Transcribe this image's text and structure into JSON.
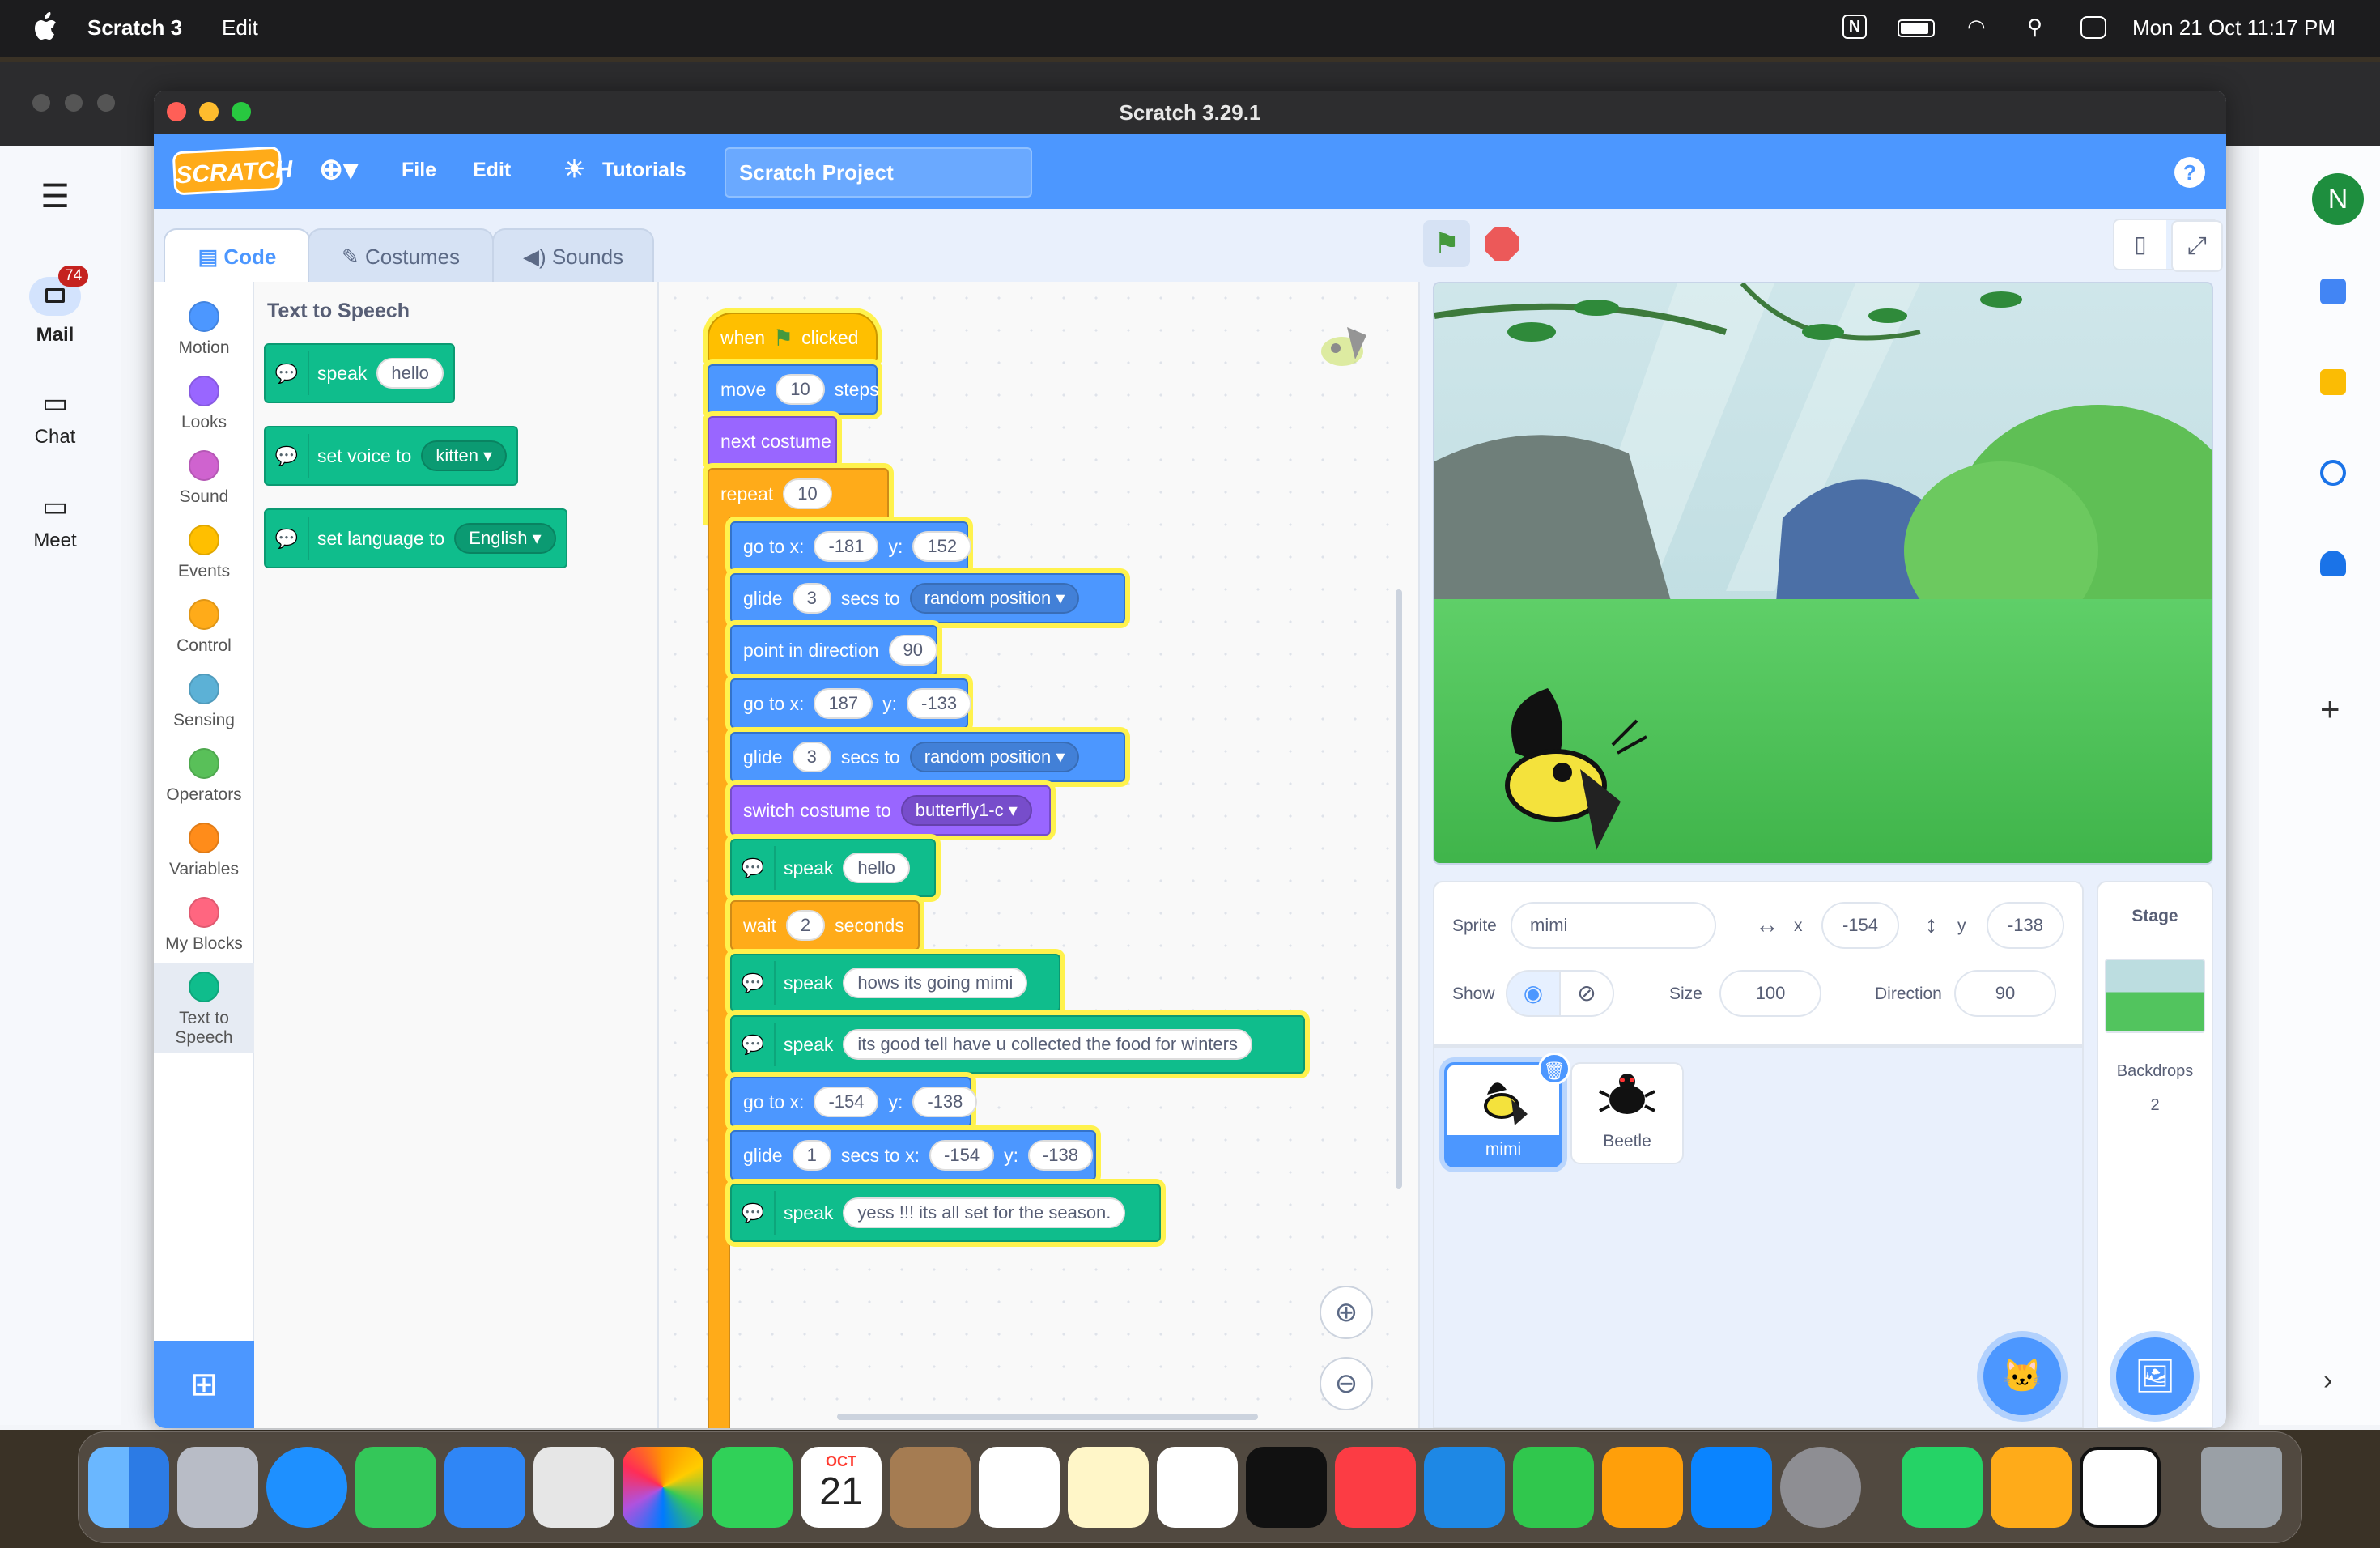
{
  "menubar": {
    "app": "Scratch 3",
    "edit": "Edit",
    "datetime": "Mon 21 Oct  11:17 PM"
  },
  "gmail": {
    "mail_label": "Mail",
    "mail_badge": "74",
    "chat_label": "Chat",
    "meet_label": "Meet",
    "avatar": "N"
  },
  "window": {
    "title": "Scratch 3.29.1"
  },
  "scratch_menu": {
    "logo": "SCRATCH",
    "file": "File",
    "edit": "Edit",
    "tutorials": "Tutorials",
    "project_title": "Scratch Project",
    "help": "?"
  },
  "tabs": {
    "code": "Code",
    "costumes": "Costumes",
    "sounds": "Sounds"
  },
  "categories": [
    {
      "label": "Motion",
      "color": "#4c97ff"
    },
    {
      "label": "Looks",
      "color": "#9966ff"
    },
    {
      "label": "Sound",
      "color": "#cf63cf"
    },
    {
      "label": "Events",
      "color": "#ffbf00"
    },
    {
      "label": "Control",
      "color": "#ffab19"
    },
    {
      "label": "Sensing",
      "color": "#5cb1d6"
    },
    {
      "label": "Operators",
      "color": "#59c059"
    },
    {
      "label": "Variables",
      "color": "#ff8c1a"
    },
    {
      "label": "My Blocks",
      "color": "#ff6680"
    },
    {
      "label": "Text to Speech",
      "color": "#0fbd8c"
    }
  ],
  "flyout": {
    "heading": "Text to Speech",
    "speak": "speak",
    "speak_val": "hello",
    "set_voice": "set voice to",
    "voice_val": "kitten",
    "set_language": "set language to",
    "language_val": "English"
  },
  "script": {
    "hat_when": "when",
    "hat_clicked": "clicked",
    "move": "move",
    "move_val": "10",
    "steps": "steps",
    "next_costume": "next costume",
    "repeat": "repeat",
    "repeat_val": "10",
    "goto1_x": "-181",
    "goto1_y": "152",
    "goto_label": "go to x:",
    "y_label": "y:",
    "glide": "glide",
    "secs_to": "secs to",
    "random_position": "random position",
    "glide1_val": "3",
    "point_dir": "point in direction",
    "point_val": "90",
    "goto2_x": "187",
    "goto2_y": "-133",
    "glide2_val": "3",
    "switch_costume": "switch costume to",
    "costume_val": "butterfly1-c",
    "speak": "speak",
    "speak1": "hello",
    "wait": "wait",
    "wait_val": "2",
    "seconds": "seconds",
    "speak2": "hows its going mimi",
    "speak3": "its good tell have u collected the food for winters",
    "goto3_x": "-154",
    "goto3_y": "-138",
    "glide3_val": "1",
    "secs_to_x": "secs to x:",
    "glide3_x": "-154",
    "glide3_y": "-138",
    "speak4": "yess !!!  its all set for the season."
  },
  "sprite_info": {
    "sprite_label": "Sprite",
    "sprite_name": "mimi",
    "x_label": "x",
    "x_val": "-154",
    "y_label": "y",
    "y_val": "-138",
    "show_label": "Show",
    "size_label": "Size",
    "size_val": "100",
    "direction_label": "Direction",
    "direction_val": "90"
  },
  "sprites": [
    {
      "name": "mimi"
    },
    {
      "name": "Beetle"
    }
  ],
  "stage_panel": {
    "title": "Stage",
    "backdrops_label": "Backdrops",
    "backdrops_count": "2"
  },
  "dock": {
    "calendar_month": "OCT",
    "calendar_day": "21"
  }
}
